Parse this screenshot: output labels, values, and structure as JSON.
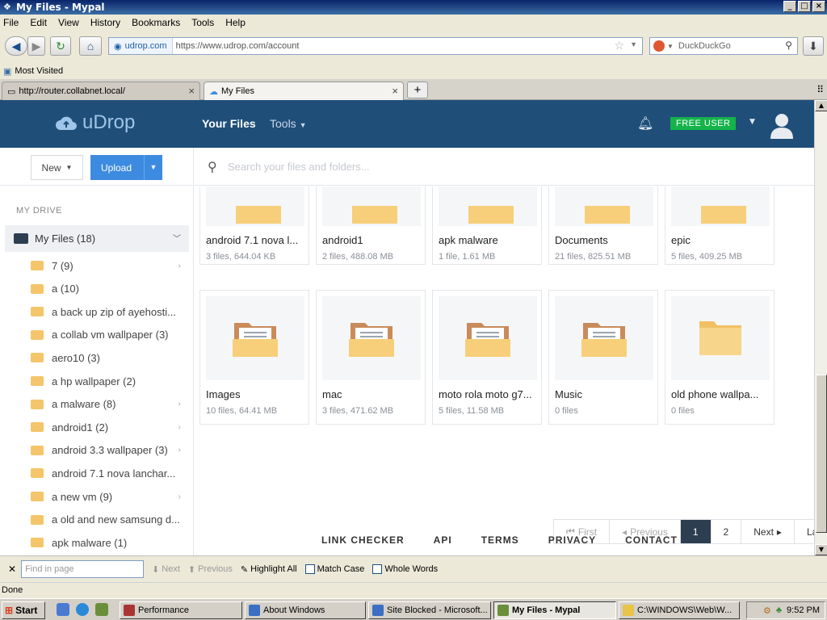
{
  "window": {
    "title": "My Files - Mypal"
  },
  "menu": [
    "File",
    "Edit",
    "View",
    "History",
    "Bookmarks",
    "Tools",
    "Help"
  ],
  "nav": {
    "site_identity": "udrop.com",
    "url": "https://www.udrop.com/account",
    "search_placeholder": "DuckDuckGo"
  },
  "bookmarks": {
    "most_visited": "Most Visited"
  },
  "tabs": [
    {
      "label": "http://router.collabnet.local/"
    },
    {
      "label": "My Files"
    }
  ],
  "app": {
    "logo_text": "uDrop",
    "nav_your_files": "Your Files",
    "nav_tools": "Tools",
    "badge": "FREE USER",
    "new_label": "New",
    "upload_label": "Upload",
    "search_placeholder": "Search your files and folders..."
  },
  "sidebar": {
    "heading": "MY DRIVE",
    "root": "My Files (18)",
    "items": [
      {
        "label": "7 (9)",
        "has_children": true
      },
      {
        "label": "a (10)",
        "has_children": false
      },
      {
        "label": "a back up zip of ayehosti...",
        "has_children": false
      },
      {
        "label": "a collab vm wallpaper (3)",
        "has_children": false
      },
      {
        "label": "aero10 (3)",
        "has_children": false
      },
      {
        "label": "a hp wallpaper (2)",
        "has_children": false
      },
      {
        "label": "a malware (8)",
        "has_children": true
      },
      {
        "label": "android1 (2)",
        "has_children": true
      },
      {
        "label": "android 3.3 wallpaper (3)",
        "has_children": true
      },
      {
        "label": "android 7.1 nova lanchar...",
        "has_children": false
      },
      {
        "label": "a new vm (9)",
        "has_children": true
      },
      {
        "label": "a old and new samsung d...",
        "has_children": false
      },
      {
        "label": "apk malware (1)",
        "has_children": false
      }
    ]
  },
  "folders_row1": [
    {
      "name": "android 7.1 nova l...",
      "meta": "3 files, 644.04 KB"
    },
    {
      "name": "android1",
      "meta": "2 files, 488.08 MB"
    },
    {
      "name": "apk malware",
      "meta": "1 file, 1.61 MB"
    },
    {
      "name": "Documents",
      "meta": "21 files, 825.51 MB"
    },
    {
      "name": "epic",
      "meta": "5 files, 409.25 MB"
    }
  ],
  "folders_row2": [
    {
      "name": "Images",
      "meta": "10 files, 64.41 MB",
      "icon": "folder-open-icon"
    },
    {
      "name": "mac",
      "meta": "3 files, 471.62 MB",
      "icon": "folder-open-icon"
    },
    {
      "name": "moto rola moto g7...",
      "meta": "5 files, 11.58 MB",
      "icon": "folder-open-icon"
    },
    {
      "name": "Music",
      "meta": "0 files",
      "icon": "folder-open-icon"
    },
    {
      "name": "old phone wallpa...",
      "meta": "0 files",
      "icon": "folder-empty-icon"
    }
  ],
  "pagination": {
    "first": "First",
    "previous": "Previous",
    "page1": "1",
    "page2": "2",
    "next": "Next",
    "last": "Last"
  },
  "footer": [
    "LINK CHECKER",
    "API",
    "TERMS",
    "PRIVACY",
    "CONTACT"
  ],
  "findbar": {
    "placeholder": "Find in page",
    "next": "Next",
    "previous": "Previous",
    "highlight_all": "Highlight All",
    "match_case": "Match Case",
    "whole_words": "Whole Words"
  },
  "status": {
    "text": "Done"
  },
  "taskbar": {
    "start": "Start",
    "tasks": [
      "Performance",
      "About Windows",
      "Site Blocked - Microsoft...",
      "My Files - Mypal",
      "C:\\WINDOWS\\Web\\W..."
    ],
    "clock": "9:52 PM"
  },
  "colors": {
    "header_bg": "#1f4e79",
    "upload_btn": "#3d8be0",
    "free_badge": "#15b34a",
    "folder": "#f7cf7a"
  }
}
